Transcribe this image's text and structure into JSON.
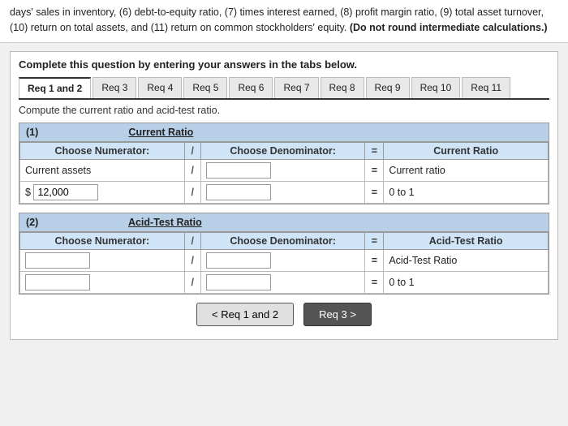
{
  "top_text": {
    "line1": "days' sales in inventory, (6) debt-to-equity ratio, (7) times interest earned, (8) profit margin ratio, (9) total asset turnover, (10) return on total assets, and (11) return on common stockholders' equity.",
    "note": "(Do not round intermediate calculations.)"
  },
  "instruction": {
    "text": "Complete this question by entering your answers in the tabs below."
  },
  "tabs": [
    {
      "label": "Req 1 and 2",
      "active": true
    },
    {
      "label": "Req 3"
    },
    {
      "label": "Req 4"
    },
    {
      "label": "Req 5"
    },
    {
      "label": "Req 6"
    },
    {
      "label": "Req 7"
    },
    {
      "label": "Req 8"
    },
    {
      "label": "Req 9"
    },
    {
      "label": "Req 10"
    },
    {
      "label": "Req 11"
    }
  ],
  "sub_instruction": "Compute the current ratio and acid-test ratio.",
  "section1": {
    "label": "(1)",
    "title": "Current Ratio",
    "row_header": {
      "numerator_label": "Choose Numerator:",
      "slash": "/",
      "denominator_label": "Choose Denominator:",
      "equals": "=",
      "result_label": "Current Ratio"
    },
    "row2": {
      "numerator_value": "Current assets",
      "slash": "/",
      "denominator_value": "",
      "equals": "=",
      "result_label": "Current ratio"
    },
    "row3": {
      "numerator_value": "$",
      "numerator_number": "12,000",
      "slash": "/",
      "denominator_value": "",
      "equals": "=",
      "result_value": "0",
      "result_suffix": "to 1"
    }
  },
  "section2": {
    "label": "(2)",
    "title": "Acid-Test Ratio",
    "row_header": {
      "numerator_label": "Choose Numerator:",
      "slash": "/",
      "denominator_label": "Choose Denominator:",
      "equals": "=",
      "result_label": "Acid-Test Ratio"
    },
    "row2": {
      "numerator_value": "",
      "slash": "/",
      "denominator_value": "",
      "equals": "=",
      "result_label": "Acid-Test Ratio"
    },
    "row3": {
      "numerator_value": "",
      "slash": "/",
      "denominator_value": "",
      "equals": "=",
      "result_value": "0",
      "result_suffix": "to 1"
    }
  },
  "nav": {
    "prev_label": "< Req 1 and 2",
    "next_label": "Req 3 >"
  }
}
